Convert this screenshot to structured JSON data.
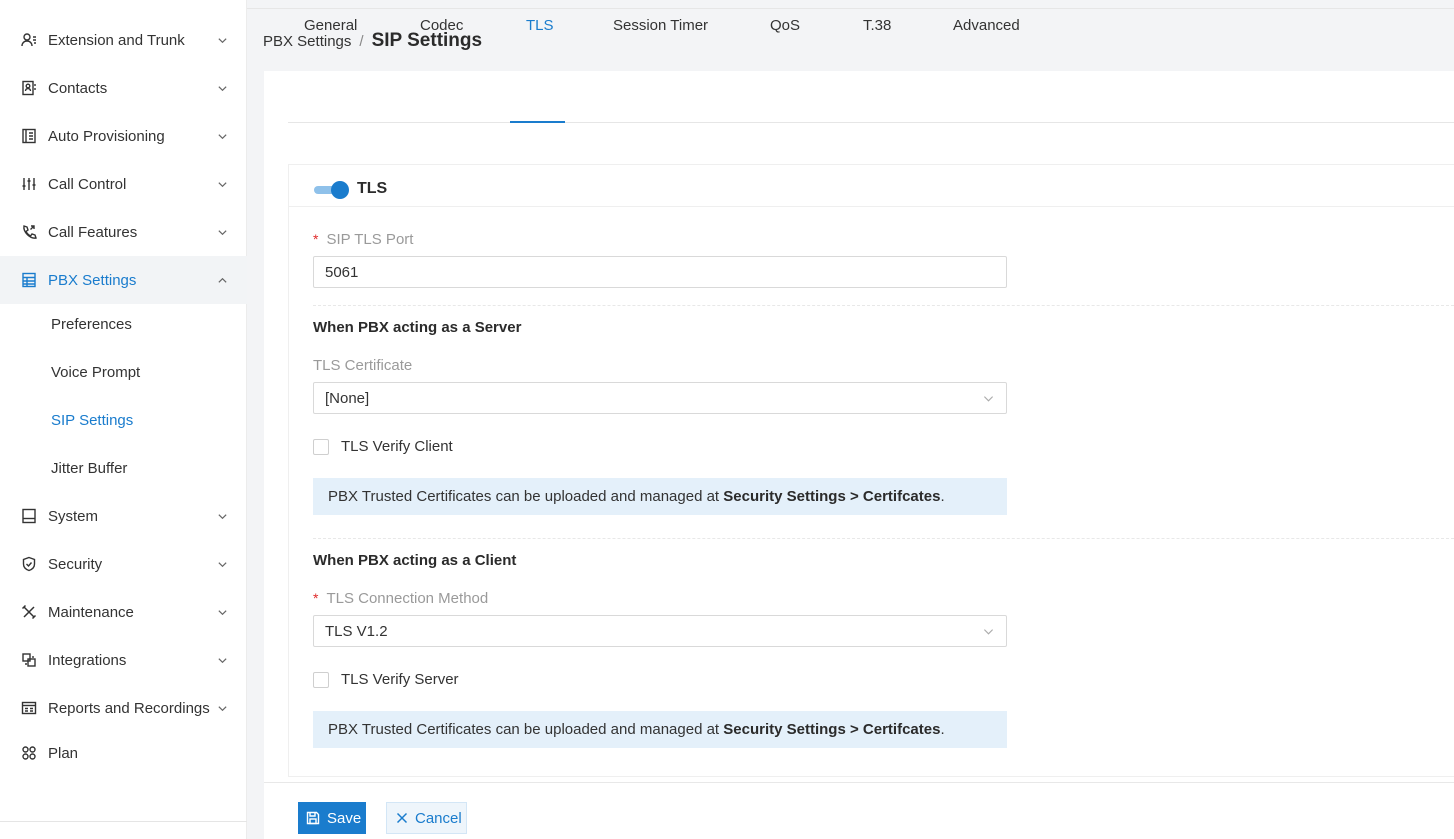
{
  "sidebar": {
    "items": [
      {
        "label": "Extension and Trunk",
        "icon": "user-list-icon"
      },
      {
        "label": "Contacts",
        "icon": "contacts-book-icon"
      },
      {
        "label": "Auto Provisioning",
        "icon": "phone-device-icon"
      },
      {
        "label": "Call Control",
        "icon": "sliders-icon"
      },
      {
        "label": "Call Features",
        "icon": "phone-forward-icon"
      },
      {
        "label": "PBX Settings",
        "icon": "settings-list-icon"
      },
      {
        "label": "System",
        "icon": "monitor-icon"
      },
      {
        "label": "Security",
        "icon": "shield-check-icon"
      },
      {
        "label": "Maintenance",
        "icon": "tools-icon"
      },
      {
        "label": "Integrations",
        "icon": "integration-icon"
      },
      {
        "label": "Reports and Recordings",
        "icon": "report-icon"
      },
      {
        "label": "Plan",
        "icon": "plan-grid-icon"
      }
    ],
    "pbx_sub_items": [
      "Preferences",
      "Voice Prompt",
      "SIP Settings",
      "Jitter Buffer"
    ],
    "active_item": "PBX Settings",
    "active_sub_item": "SIP Settings"
  },
  "breadcrumb": {
    "parent": "PBX Settings",
    "separator": "/",
    "current": "SIP Settings"
  },
  "tabs": [
    "General",
    "Codec",
    "TLS",
    "Session Timer",
    "QoS",
    "T.38",
    "Advanced"
  ],
  "active_tab": "TLS",
  "tls": {
    "title": "TLS",
    "enabled": true,
    "sip_tls_port_label": "SIP TLS Port",
    "sip_tls_port_value": "5061",
    "required_marker": "*",
    "server_section_title": "When PBX acting as a Server",
    "tls_certificate_label": "TLS Certificate",
    "tls_certificate_value": "[None]",
    "tls_verify_client_label": "TLS Verify Client",
    "tls_verify_client_checked": false,
    "info_text_prefix": "PBX Trusted Certificates can be uploaded and managed at ",
    "info_text_link": "Security Settings > Certifcates",
    "info_text_suffix": ".",
    "client_section_title": "When PBX acting as a Client",
    "tls_connection_method_label": "TLS Connection Method",
    "tls_connection_method_value": "TLS V1.2",
    "tls_verify_server_label": "TLS Verify Server",
    "tls_verify_server_checked": false
  },
  "footer": {
    "save_label": "Save",
    "cancel_label": "Cancel"
  },
  "colors": {
    "accent": "#1a7ccd",
    "info_bg": "#e4f0fa",
    "required": "#e02b2b"
  }
}
